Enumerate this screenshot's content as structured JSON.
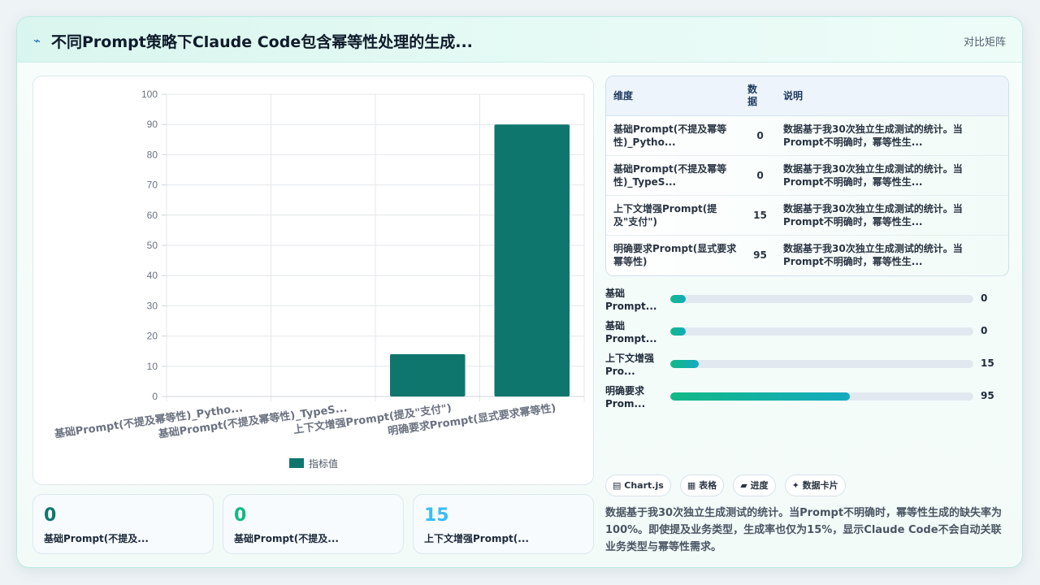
{
  "header": {
    "icon": "bolt-icon",
    "title": "不同Prompt策略下Claude Code包含幂等性处理的生成...",
    "mode_label": "对比矩阵"
  },
  "colors": {
    "bar": "#0f766e",
    "kpi_dark": "#0f766e",
    "kpi_green": "#12b886",
    "kpi_blue": "#38bdf8",
    "progress_start": "#12b886",
    "progress_end": "#15aabf"
  },
  "chart_data": {
    "type": "bar",
    "categories": [
      "基础Prompt(不提及幂等性)_Pytho...",
      "基础Prompt(不提及幂等性)_TypeS...",
      "上下文增强Prompt(提及\"支付\")",
      "明确要求Prompt(显式要求幂等性)"
    ],
    "series": [
      {
        "name": "指标值",
        "values": [
          0,
          0,
          14,
          90
        ]
      }
    ],
    "ylim": [
      0,
      100
    ],
    "yticks": [
      0,
      10,
      20,
      30,
      40,
      50,
      60,
      70,
      80,
      90,
      100
    ],
    "xlabel": "",
    "ylabel": "",
    "grid": true,
    "legend": "bottom"
  },
  "kpis": [
    {
      "value": "0",
      "label": "基础Prompt(不提及...",
      "color": "#0f766e"
    },
    {
      "value": "0",
      "label": "基础Prompt(不提及...",
      "color": "#12b886"
    },
    {
      "value": "15",
      "label": "上下文增强Prompt(...",
      "color": "#38bdf8"
    }
  ],
  "table": {
    "headers": [
      "维度",
      "数据",
      "说明"
    ],
    "rows": [
      {
        "dim": "基础Prompt(不提及幂等性)_Pytho...",
        "num": "0",
        "desc": "数据基于我30次独立生成测试的统计。当Prompt不明确时，幂等性生..."
      },
      {
        "dim": "基础Prompt(不提及幂等性)_TypeS...",
        "num": "0",
        "desc": "数据基于我30次独立生成测试的统计。当Prompt不明确时，幂等性生..."
      },
      {
        "dim": "上下文增强Prompt(提及\"支付\")",
        "num": "15",
        "desc": "数据基于我30次独立生成测试的统计。当Prompt不明确时，幂等性生..."
      },
      {
        "dim": "明确要求Prompt(显式要求幂等性)",
        "num": "95",
        "desc": "数据基于我30次独立生成测试的统计。当Prompt不明确时，幂等性生..."
      }
    ]
  },
  "progress": [
    {
      "label": "基础Prompt...",
      "value": "0",
      "fraction": 0.05
    },
    {
      "label": "基础Prompt...",
      "value": "0",
      "fraction": 0.05
    },
    {
      "label": "上下文增强Pro...",
      "value": "15",
      "fraction": 0.095
    },
    {
      "label": "明确要求Prom...",
      "value": "95",
      "fraction": 0.593
    }
  ],
  "tags": [
    {
      "icon": "chart-icon",
      "label": "Chart.js"
    },
    {
      "icon": "table-icon",
      "label": "表格"
    },
    {
      "icon": "progress-icon",
      "label": "进度"
    },
    {
      "icon": "sparkle-icon",
      "label": "数据卡片"
    }
  ],
  "note": "数据基于我30次独立生成测试的统计。当Prompt不明确时，幂等性生成的缺失率为100%。即使提及业务类型，生成率也仅为15%，显示Claude Code不会自动关联业务类型与幂等性需求。"
}
